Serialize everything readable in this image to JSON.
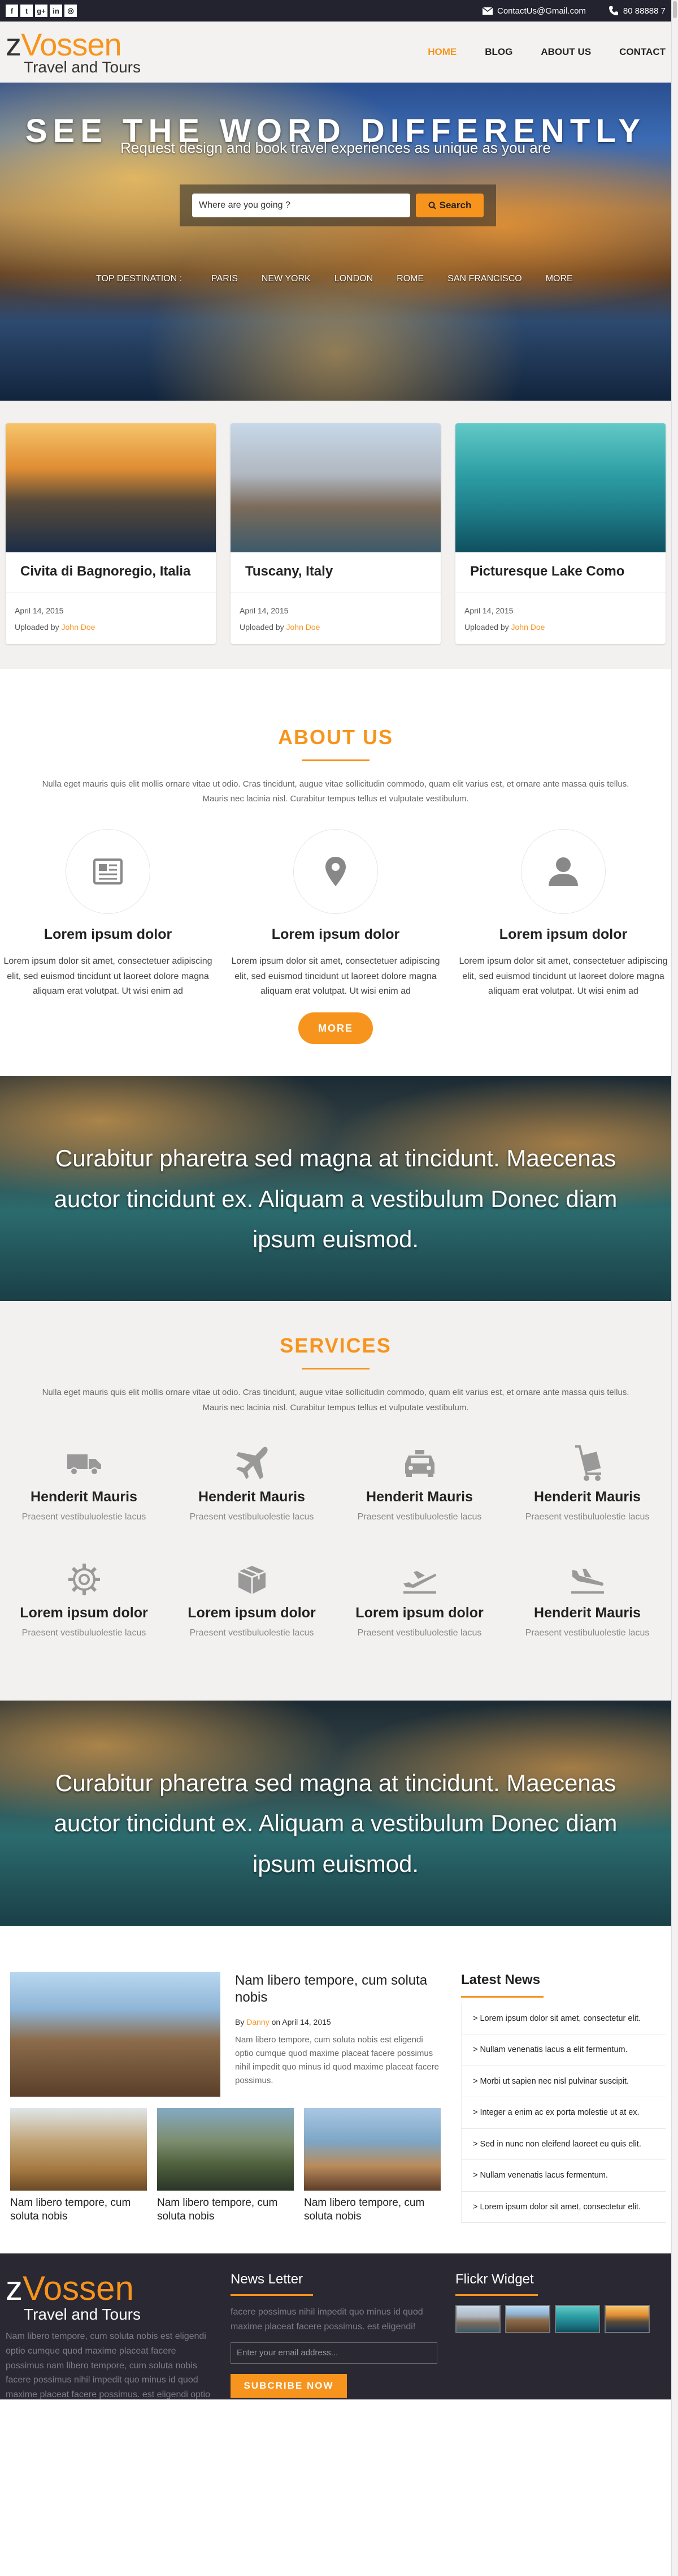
{
  "topbar": {
    "socials": [
      "f",
      "t",
      "g+",
      "in",
      "◎"
    ],
    "email": "ContactUs@Gmail.com",
    "phone": "80 88888 7"
  },
  "nav": {
    "brand_first": "z",
    "brand_rest": "Vossen",
    "tagline": "Travel and Tours",
    "menu": [
      "HOME",
      "BLOG",
      "ABOUT US",
      "CONTACT"
    ]
  },
  "hero": {
    "title": "SEE THE WORD DIFFERENTLY",
    "subtitle": "Request design and book travel experiences as unique as you are",
    "search_placeholder": "Where are you going ?",
    "search_button": "Search",
    "destinations_label": "TOP DESTINATION :",
    "destinations": [
      "PARIS",
      "NEW YORK",
      "LONDON",
      "ROME",
      "SAN FRANCISCO",
      "MORE"
    ]
  },
  "cards": [
    {
      "title": "Civita di Bagnoregio, Italia",
      "date": "April 14, 2015",
      "uploaded": "Uploaded by",
      "author": "John Doe"
    },
    {
      "title": "Tuscany, Italy",
      "date": "April 14, 2015",
      "uploaded": "Uploaded by",
      "author": "John Doe"
    },
    {
      "title": "Picturesque Lake Como",
      "date": "April 14, 2015",
      "uploaded": "Uploaded by",
      "author": "John Doe"
    }
  ],
  "about": {
    "title": "ABOUT US",
    "description": "Nulla eget mauris quis elit mollis ornare vitae ut odio. Cras tincidunt, augue vitae sollicitudin commodo, quam elit varius est, et ornare ante massa quis tellus. Mauris nec lacinia nisl. Curabitur tempus tellus et vulputate vestibulum.",
    "features": [
      {
        "icon": "newspaper-icon",
        "title": "Lorem ipsum dolor",
        "text": "Lorem ipsum dolor sit amet, consectetuer adipiscing elit, sed euismod tincidunt ut laoreet dolore magna aliquam erat volutpat. Ut wisi enim ad"
      },
      {
        "icon": "map-pin-icon",
        "title": "Lorem ipsum dolor",
        "text": "Lorem ipsum dolor sit amet, consectetuer adipiscing elit, sed euismod tincidunt ut laoreet dolore magna aliquam erat volutpat. Ut wisi enim ad"
      },
      {
        "icon": "user-icon",
        "title": "Lorem ipsum dolor",
        "text": "Lorem ipsum dolor sit amet, consectetuer adipiscing elit, sed euismod tincidunt ut laoreet dolore magna aliquam erat volutpat. Ut wisi enim ad"
      }
    ],
    "more_button": "MORE"
  },
  "quote": "Curabitur pharetra sed magna at tincidunt. Maecenas auctor tincidunt ex. Aliquam a vestibulum Donec diam ipsum euismod.",
  "services": {
    "title": "SERVICES",
    "description": "Nulla eget mauris quis elit mollis ornare vitae ut odio. Cras tincidunt, augue vitae sollicitudin commodo, quam elit varius est, et ornare ante massa quis tellus. Mauris nec lacinia nisl. Curabitur tempus tellus et vulputate vestibulum.",
    "items": [
      {
        "icon": "truck-icon",
        "title": "Henderit Mauris",
        "text": "Praesent vestibuluolestie lacus"
      },
      {
        "icon": "airplane-icon",
        "title": "Henderit Mauris",
        "text": "Praesent vestibuluolestie lacus"
      },
      {
        "icon": "taxi-icon",
        "title": "Henderit Mauris",
        "text": "Praesent vestibuluolestie lacus"
      },
      {
        "icon": "luggage-cart-icon",
        "title": "Henderit Mauris",
        "text": "Praesent vestibuluolestie lacus"
      },
      {
        "icon": "gear-icon",
        "title": "Lorem ipsum dolor",
        "text": "Praesent vestibuluolestie lacus"
      },
      {
        "icon": "box-icon",
        "title": "Lorem ipsum dolor",
        "text": "Praesent vestibuluolestie lacus"
      },
      {
        "icon": "plane-departure-icon",
        "title": "Lorem ipsum dolor",
        "text": "Praesent vestibuluolestie lacus"
      },
      {
        "icon": "plane-arrival-icon",
        "title": "Henderit Mauris",
        "text": "Praesent vestibuluolestie lacus"
      }
    ]
  },
  "news": {
    "featured": {
      "title": "Nam libero tempore, cum soluta nobis",
      "by": "By",
      "author": "Danny",
      "date": "on April 14, 2015",
      "body": "Nam libero tempore, cum soluta nobis est eligendi optio cumque quod maxime placeat facere possimus nihil impedit quo minus id quod maxime placeat facere possimus."
    },
    "thumbs": [
      {
        "title": "Nam libero tempore, cum soluta nobis"
      },
      {
        "title": "Nam libero tempore, cum soluta nobis"
      },
      {
        "title": "Nam libero tempore, cum soluta nobis"
      }
    ],
    "latest_title": "Latest News",
    "latest": [
      "> Lorem ipsum dolor sit amet, consectetur elit.",
      "> Nullam venenatis lacus a elit fermentum.",
      "> Morbi ut sapien nec nisl pulvinar suscipit.",
      "> Integer a enim ac ex porta molestie ut at ex.",
      "> Sed in nunc non eleifend laoreet eu quis elit.",
      "> Nullam venenatis lacus fermentum.",
      "> Lorem ipsum dolor sit amet, consectetur elit."
    ]
  },
  "footer": {
    "brand_first": "z",
    "brand_rest": "Vossen",
    "tagline": "Travel and Tours",
    "about_text": "Nam libero tempore, cum soluta nobis est eligendi optio cumque quod maxime placeat facere possimus nam libero tempore, cum soluta nobis facere possimus nihil impedit quo minus id quod maxime placeat facere possimus. est eligendi optio cumque.",
    "newsletter_title": "News Letter",
    "newsletter_text": "facere possimus nihil impedit quo minus id quod maxime placeat facere possimus. est eligendi!",
    "email_placeholder": "Enter your email address...",
    "subscribe_button": "SUBCRIBE NOW",
    "flickr_title": "Flickr Widget"
  },
  "colors": {
    "accent": "#f7941d",
    "dark": "#23232f",
    "footer": "#2a2833",
    "section_bg": "#f2f1ef"
  }
}
